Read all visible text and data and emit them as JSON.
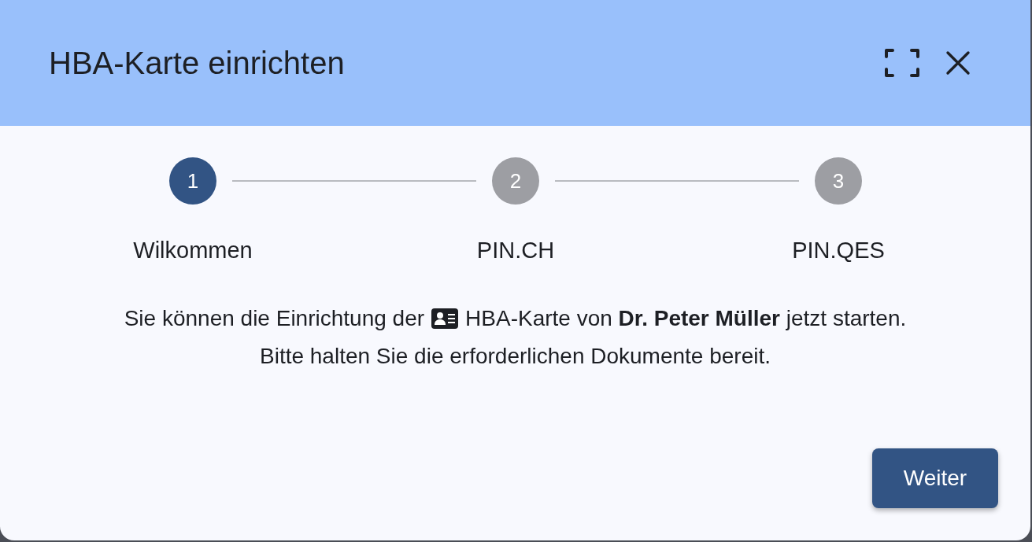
{
  "dialog": {
    "title": "HBA-Karte einrichten"
  },
  "steps": [
    {
      "number": "1",
      "label": "Wilkommen",
      "selected": true
    },
    {
      "number": "2",
      "label": "PIN.CH",
      "selected": false
    },
    {
      "number": "3",
      "label": "PIN.QES",
      "selected": false
    }
  ],
  "message": {
    "before_icon": "Sie können die Einrichtung der",
    "after_icon": "HBA-Karte von **Dr. Peter Müller** jetzt starten.",
    "second_line": "Bitte halten Sie die erforderlichen Dokumente bereit."
  },
  "buttons": [
    {
      "label": "Weiter"
    }
  ]
}
